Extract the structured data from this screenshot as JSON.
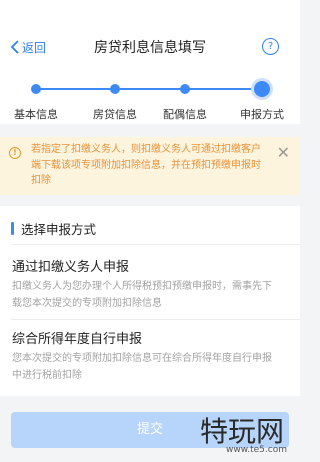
{
  "nav": {
    "back_label": "返回",
    "title": "房贷利息信息填写",
    "help_label": "?"
  },
  "steps": [
    {
      "label": "基本信息",
      "state": "done"
    },
    {
      "label": "房贷信息",
      "state": "done"
    },
    {
      "label": "配偶信息",
      "state": "done"
    },
    {
      "label": "申报方式",
      "state": "current"
    }
  ],
  "notice": {
    "text": "若指定了扣缴义务人，则扣缴义务人可通过扣缴客户端下载该项专项附加扣除信息，并在预扣预缴申报时扣除"
  },
  "section": {
    "title": "选择申报方式"
  },
  "options": [
    {
      "title": "通过扣缴义务人申报",
      "desc": "扣缴义务人为您办理个人所得税预扣预缴申报时，需事先下载您本次提交的专项附加扣除信息"
    },
    {
      "title": "综合所得年度自行申报",
      "desc": "您本次提交的专项附加扣除信息可在综合所得年度自行申报中进行税前扣除"
    }
  ],
  "submit_label": "提交",
  "watermark": {
    "big": "特玩网",
    "small": "www.te5.com"
  },
  "colors": {
    "accent": "#3d8af7",
    "warning_bg": "#fdf4de",
    "warning_text": "#e7923a",
    "submit_disabled": "#b7d4fb"
  }
}
